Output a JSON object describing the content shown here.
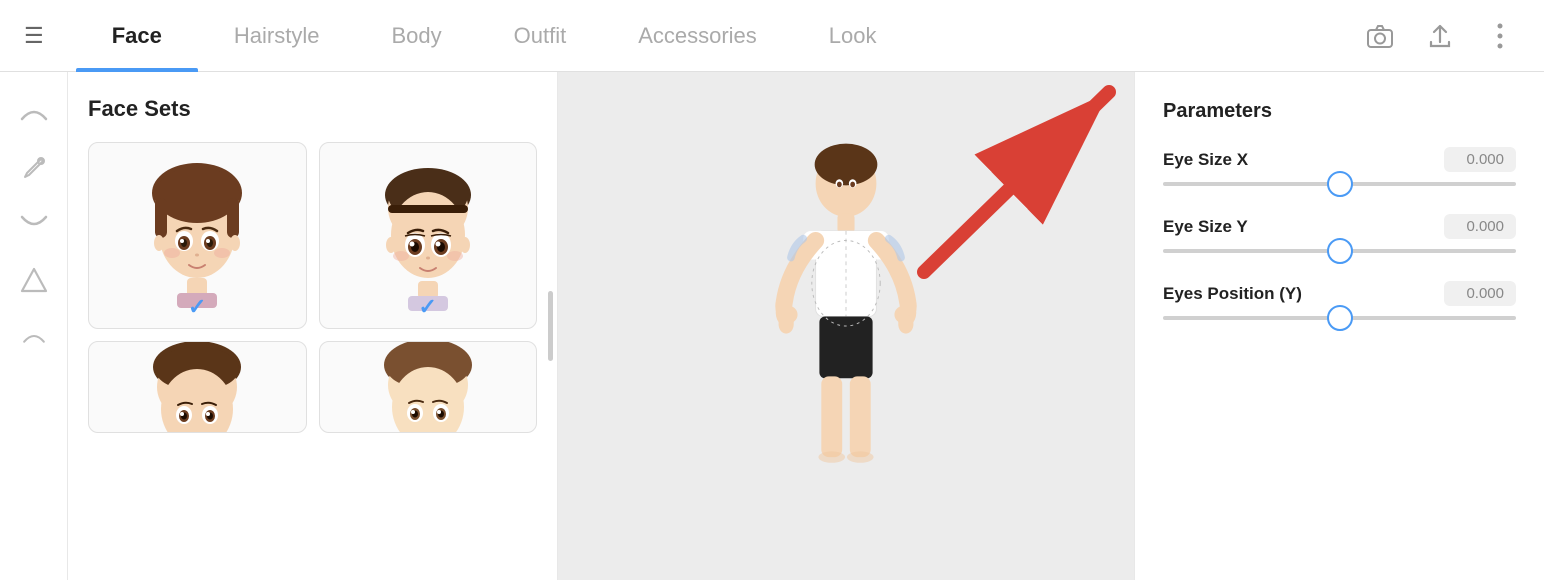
{
  "header": {
    "tabs": [
      {
        "id": "face",
        "label": "Face",
        "active": true
      },
      {
        "id": "hairstyle",
        "label": "Hairstyle",
        "active": false
      },
      {
        "id": "body",
        "label": "Body",
        "active": false
      },
      {
        "id": "outfit",
        "label": "Outfit",
        "active": false
      },
      {
        "id": "accessories",
        "label": "Accessories",
        "active": false
      },
      {
        "id": "look",
        "label": "Look",
        "active": false
      }
    ],
    "hamburger": "☰",
    "camera_icon": "📷",
    "share_icon": "⬆",
    "more_icon": "⋮"
  },
  "sidebar": {
    "icons": [
      {
        "id": "arc-top",
        "symbol": "⌒"
      },
      {
        "id": "pen-tool",
        "symbol": "✒"
      },
      {
        "id": "arc-bottom",
        "symbol": "⌣"
      },
      {
        "id": "triangle",
        "symbol": "△"
      },
      {
        "id": "arc-small",
        "symbol": "⌢"
      }
    ]
  },
  "face_panel": {
    "title": "Face Sets",
    "cards": [
      {
        "id": 1,
        "checked": true
      },
      {
        "id": 2,
        "checked": true
      },
      {
        "id": 3,
        "cropped": true
      },
      {
        "id": 4,
        "cropped": true
      }
    ]
  },
  "parameters": {
    "title": "Parameters",
    "params": [
      {
        "id": "eye-size-x",
        "label": "Eye Size X",
        "value": "0.000",
        "thumb_pct": 50
      },
      {
        "id": "eye-size-y",
        "label": "Eye Size Y",
        "value": "0.000",
        "thumb_pct": 50
      },
      {
        "id": "eyes-position-y",
        "label": "Eyes Position (Y)",
        "value": "0.000",
        "thumb_pct": 50
      }
    ]
  },
  "colors": {
    "accent_blue": "#4a9af5",
    "arrow_red": "#d94035",
    "slider_track": "#d0d0d0",
    "active_tab_indicator": "#4a9af5"
  }
}
